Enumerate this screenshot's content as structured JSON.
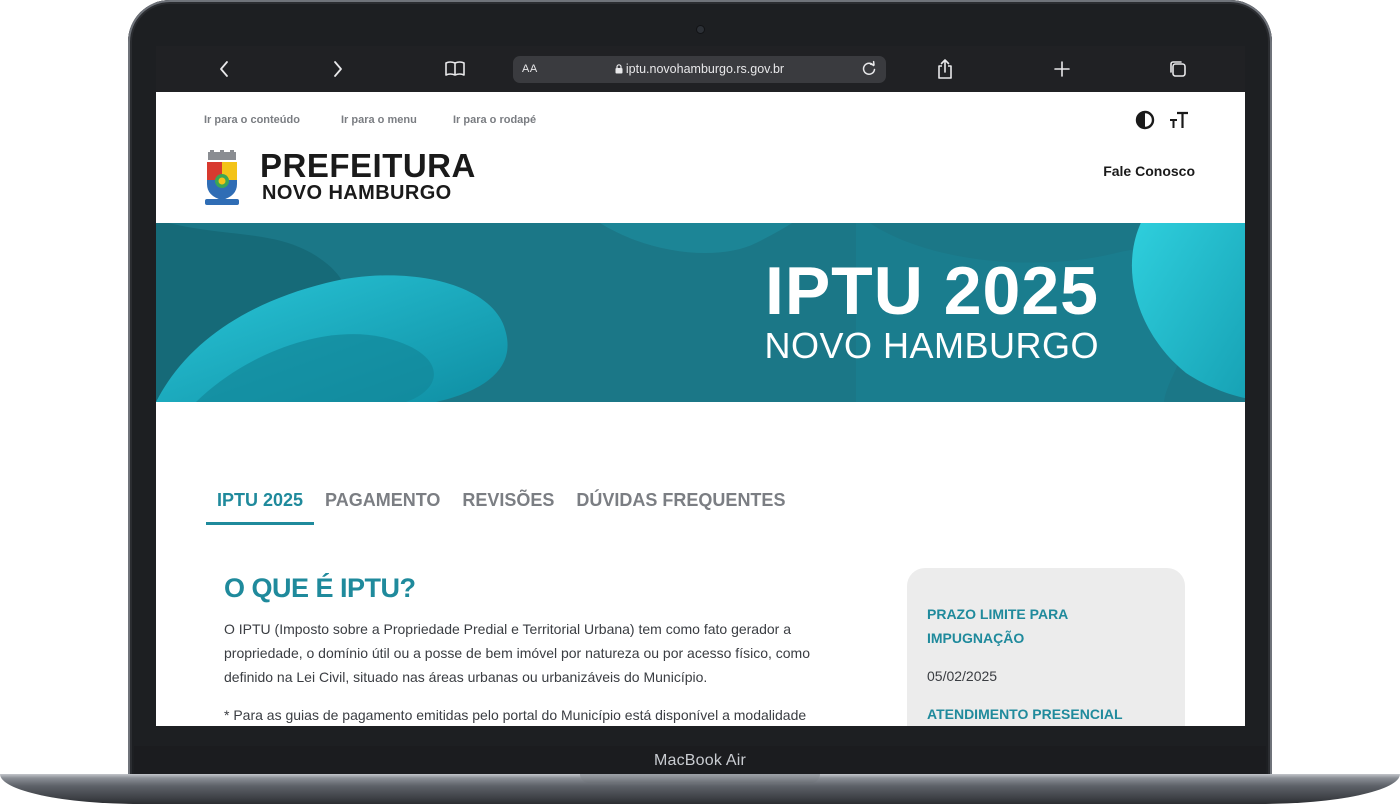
{
  "browser": {
    "address_aa": "AA",
    "url": "iptu.novohamburgo.rs.gov.br"
  },
  "device": {
    "label": "MacBook Air"
  },
  "skip_links": [
    "Ir para o conteúdo",
    "Ir para o menu",
    "Ir para o rodapé"
  ],
  "header": {
    "brand_line1": "PREFEITURA",
    "brand_line2": "NOVO HAMBURGO",
    "contact": "Fale Conosco"
  },
  "banner": {
    "title": "IPTU 2025",
    "subtitle": "NOVO HAMBURGO"
  },
  "tabs": [
    "IPTU 2025",
    "PAGAMENTO",
    "REVISÕES",
    "DÚVIDAS FREQUENTES"
  ],
  "content": {
    "heading": "O QUE É IPTU?",
    "paragraph": "O IPTU (Imposto sobre a Propriedade Predial e Territorial Urbana) tem como fato gerador a propriedade, o domínio útil ou a posse de bem imóvel por natureza ou por acesso físico, como definido na Lei Civil, situado nas áreas urbanas ou urbanizáveis do Município.",
    "note": "* Para as guias de pagamento emitidas pelo portal do Município está disponível a modalidade"
  },
  "sidebar": {
    "deadline_label": "PRAZO LIMITE PARA IMPUGNAÇÃO",
    "deadline_value": "05/02/2025",
    "attendance_label": "ATENDIMENTO PRESENCIAL"
  },
  "colors": {
    "accent": "#1f8a9c",
    "banner": "#1b7787",
    "toolbar": "#202124"
  }
}
